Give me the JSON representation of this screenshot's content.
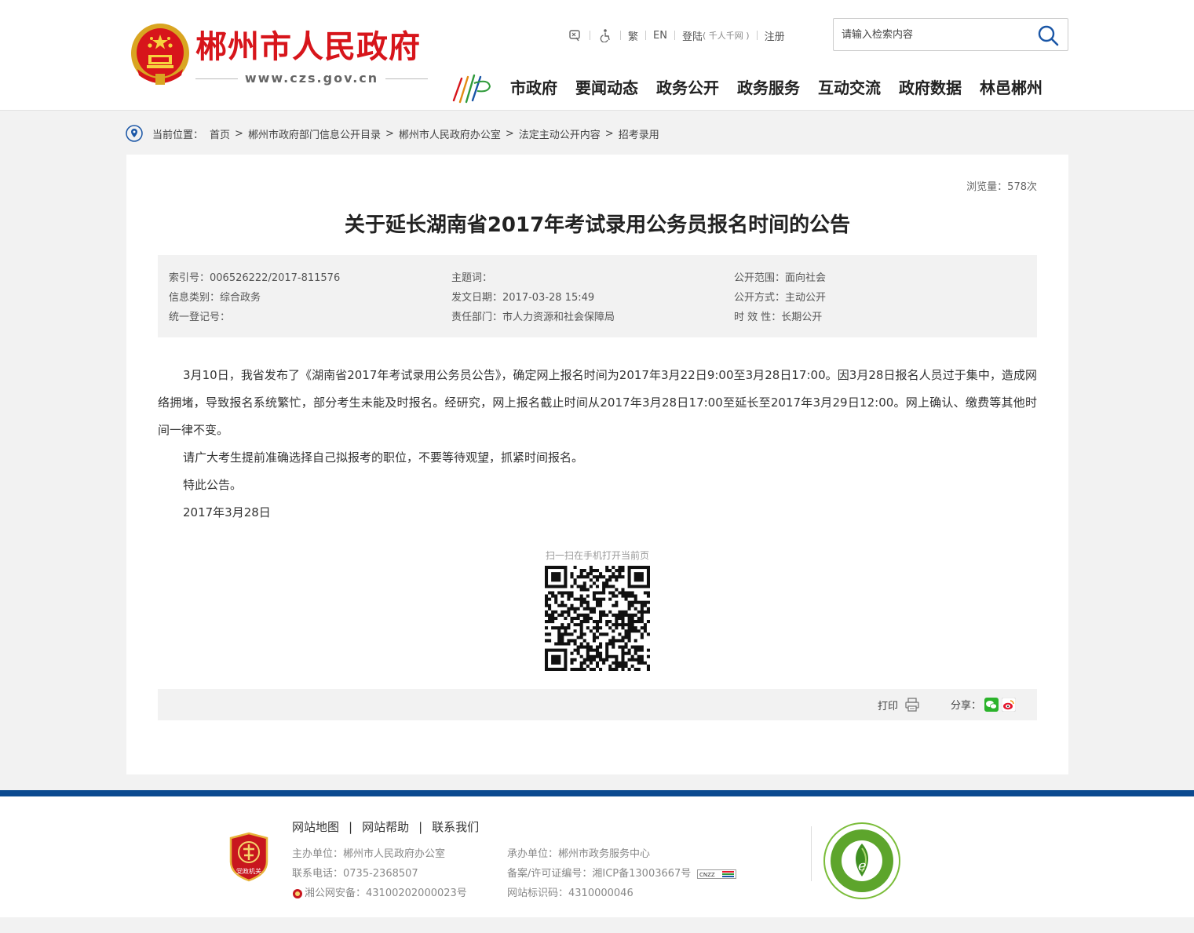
{
  "header": {
    "site_name": "郴州市人民政府",
    "site_url": "www.czs.gov.cn",
    "top_links": {
      "traditional": "繁",
      "english": "EN",
      "login": "登陆",
      "login_sub": "( 千人千网 )",
      "register": "注册"
    },
    "search": {
      "placeholder": "请输入检索内容",
      "value": ""
    },
    "nav": [
      "市政府",
      "要闻动态",
      "政务公开",
      "政务服务",
      "互动交流",
      "政府数据",
      "林邑郴州"
    ]
  },
  "breadcrumb": {
    "label": "当前位置：",
    "items": [
      "首页",
      "郴州市政府部门信息公开目录",
      "郴州市人民政府办公室",
      "法定主动公开内容",
      "招考录用"
    ]
  },
  "article": {
    "views": "浏览量：578次",
    "title": "关于延长湖南省2017年考试录用公务员报名时间的公告",
    "meta": {
      "col1": [
        "索引号：006526222/2017-811576",
        "信息类别：综合政务",
        "统一登记号："
      ],
      "col2": [
        "主题词：",
        "发文日期：2017-03-28 15:49",
        "责任部门：市人力资源和社会保障局"
      ],
      "col3": [
        "公开范围：面向社会",
        "公开方式：主动公开",
        "时 效 性：长期公开"
      ]
    },
    "paragraphs": [
      "3月10日，我省发布了《湖南省2017年考试录用公务员公告》，确定网上报名时间为2017年3月22日9:00至3月28日17:00。因3月28日报名人员过于集中，造成网络拥堵，导致报名系统繁忙，部分考生未能及时报名。经研究，网上报名截止时间从2017年3月28日17:00至延长至2017年3月29日12:00。网上确认、缴费等其他时间一律不变。",
      "请广大考生提前准确选择自己拟报考的职位，不要等待观望，抓紧时间报名。",
      "特此公告。",
      "2017年3月28日"
    ],
    "qr_caption": "扫一扫在手机打开当前页",
    "print_label": "打印",
    "share_label": "分享："
  },
  "footer": {
    "links": [
      "网站地图",
      "网站帮助",
      "联系我们"
    ],
    "info_left": [
      "主办单位：郴州市人民政府办公室",
      "联系电话：0735-2368507",
      "湘公网安备：43100202000023号"
    ],
    "info_right": [
      "承办单位：郴州市政务服务中心",
      "备案/许可证编号：湘ICP备13003667号",
      "网站标识码：4310000046"
    ],
    "dzjg_label": "党政机关",
    "cnzz_label": "CNZZ"
  },
  "colors": {
    "brand_red": "#d7151b",
    "footer_blue": "#0b4a8f",
    "panel_gray": "#f2f2f2"
  }
}
